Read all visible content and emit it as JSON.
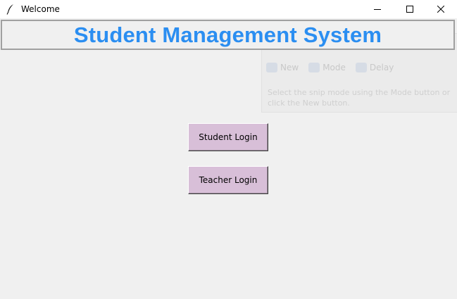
{
  "window": {
    "title": "Welcome",
    "app_icon": "feather-icon",
    "controls": [
      "minimize-icon",
      "maximize-icon",
      "close-icon"
    ]
  },
  "header": {
    "title": "Student Management System",
    "title_color": "#2b8ef1"
  },
  "buttons": {
    "student_login": "Student Login",
    "teacher_login": "Teacher Login",
    "background": "#d8bfd8"
  },
  "snip_overlay": {
    "new_label": "New",
    "mode_label": "Mode",
    "delay_label": "Delay",
    "help_text": "Select the snip mode using the Mode button or click the New button."
  }
}
